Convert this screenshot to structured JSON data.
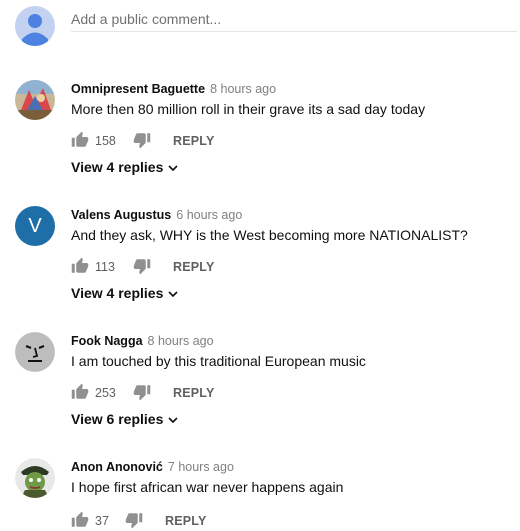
{
  "add_comment": {
    "placeholder": "Add a public comment..."
  },
  "comments": [
    {
      "author": "Omnipresent Baguette",
      "time": "8 hours ago",
      "text": "More then 80 million roll in their grave its a sad day today",
      "likes": "158",
      "reply_label": "REPLY",
      "view_replies": "View 4 replies",
      "avatar": "collage-avatar"
    },
    {
      "author": "Valens Augustus",
      "time": "6 hours ago",
      "text": "And they ask, WHY is the West becoming more NATIONALIST?",
      "likes": "113",
      "reply_label": "REPLY",
      "view_replies": "View 4 replies",
      "avatar": "letter-avatar",
      "avatar_letter": "V",
      "avatar_color": "#1e6ea8"
    },
    {
      "author": "Fook Nagga",
      "time": "8 hours ago",
      "text": "I am touched by this traditional European music",
      "likes": "253",
      "reply_label": "REPLY",
      "view_replies": "View 6 replies",
      "avatar": "face-avatar"
    },
    {
      "author": "Anon Anonović",
      "time": "7 hours ago",
      "text": "I hope first african war never happens again",
      "likes": "37",
      "reply_label": "REPLY",
      "avatar": "soldier-avatar"
    }
  ]
}
